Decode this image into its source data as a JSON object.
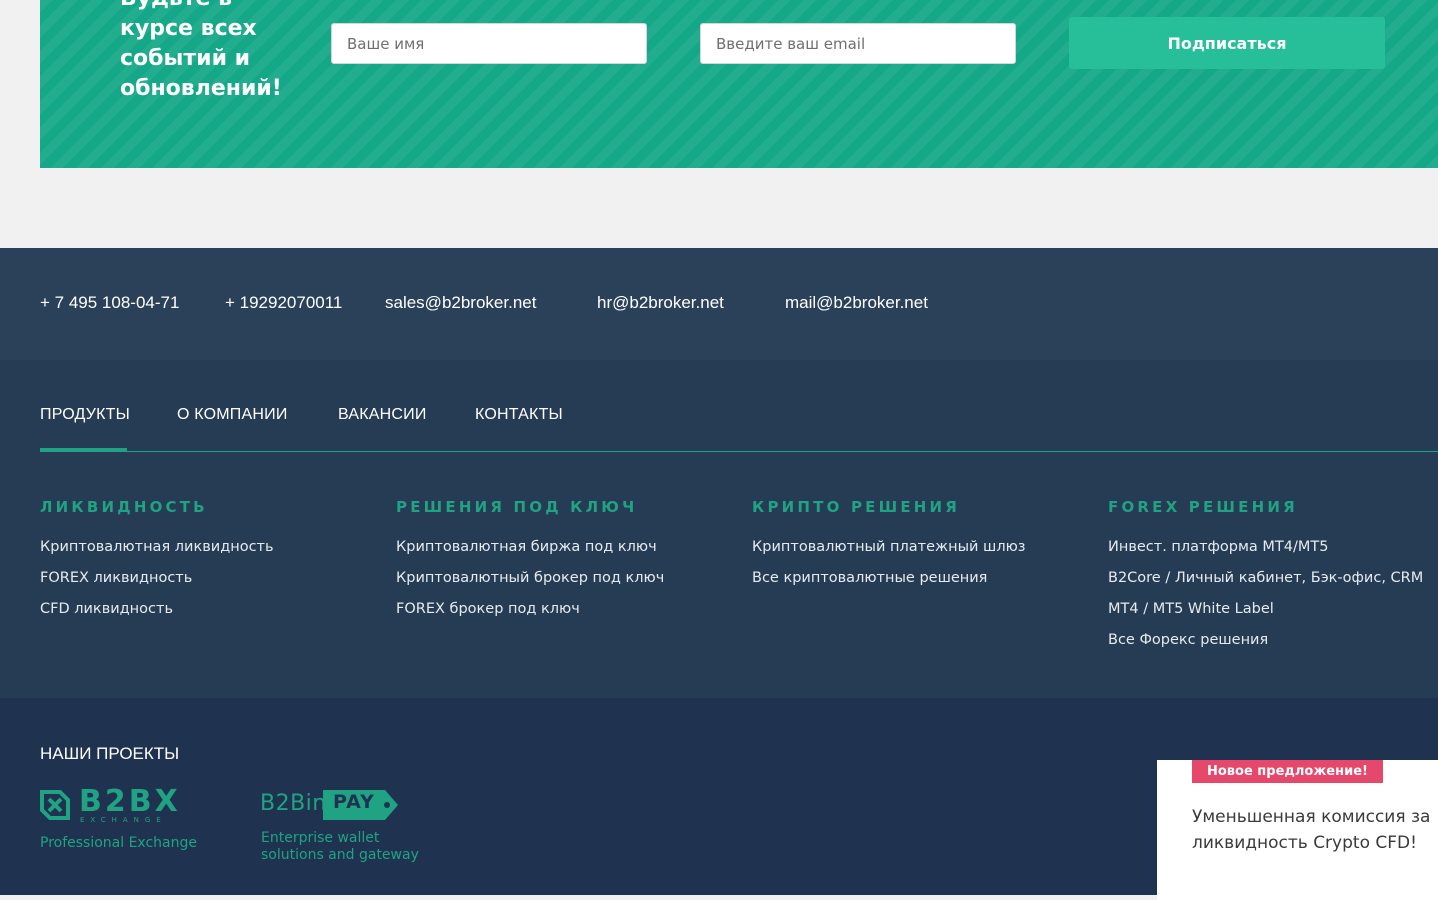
{
  "subscribe": {
    "heading": "Будьте в\nкурсе всех\nсобытий и\nобновлений!",
    "name_placeholder": "Ваше имя",
    "email_placeholder": "Введите ваш email",
    "button_label": "Подписаться"
  },
  "contacts": {
    "phone1": "+ 7 495 108-04-71",
    "phone2": "+ 19292070011",
    "email_sales": "sales@b2broker.net",
    "email_hr": "hr@b2broker.net",
    "email_mail": "mail@b2broker.net"
  },
  "tabs": [
    {
      "label": "ПРОДУКТЫ",
      "active": true
    },
    {
      "label": "О КОМПАНИИ"
    },
    {
      "label": "ВАКАНСИИ"
    },
    {
      "label": "КОНТАКТЫ"
    }
  ],
  "columns": [
    {
      "title": "ЛИКВИДНОСТЬ",
      "links": [
        "Криптовалютная ликвидность",
        "FOREX ликвидность",
        "CFD ликвидность"
      ]
    },
    {
      "title": "РЕШЕНИЯ ПОД КЛЮЧ",
      "links": [
        "Криптовалютная биржа под ключ",
        "Криптовалютный брокер под ключ",
        "FOREX брокер под ключ"
      ]
    },
    {
      "title": "КРИПТО РЕШЕНИЯ",
      "links": [
        "Криптовалютный платежный шлюз",
        "Все криптовалютные решения"
      ]
    },
    {
      "title": "FOREX РЕШЕНИЯ",
      "links": [
        "Инвест. платформа MT4/MT5",
        "B2Core / Личный кабинет, Бэк-офис, CRM",
        "MT4 / MT5 White Label",
        "Все Форекс решения"
      ]
    }
  ],
  "projects": {
    "heading": "НАШИ ПРОЕКТЫ",
    "b2bx": {
      "name": "B2BX",
      "sub": "EXCHANGE",
      "caption": "Professional Exchange"
    },
    "b2binpay": {
      "name_left": "B2Bin",
      "name_right": "PAY",
      "caption": "Enterprise wallet\nsolutions and gateway"
    }
  },
  "promo": {
    "badge": "Новое предложение!",
    "text": "Уменьшенная комиссия за ликвидность Crypto CFD!"
  },
  "colors": {
    "accent": "#1fa383",
    "subscribe_bg": "#14a888",
    "button": "#26bf9a",
    "navy": "#263c54",
    "badge": "#e5486a"
  }
}
